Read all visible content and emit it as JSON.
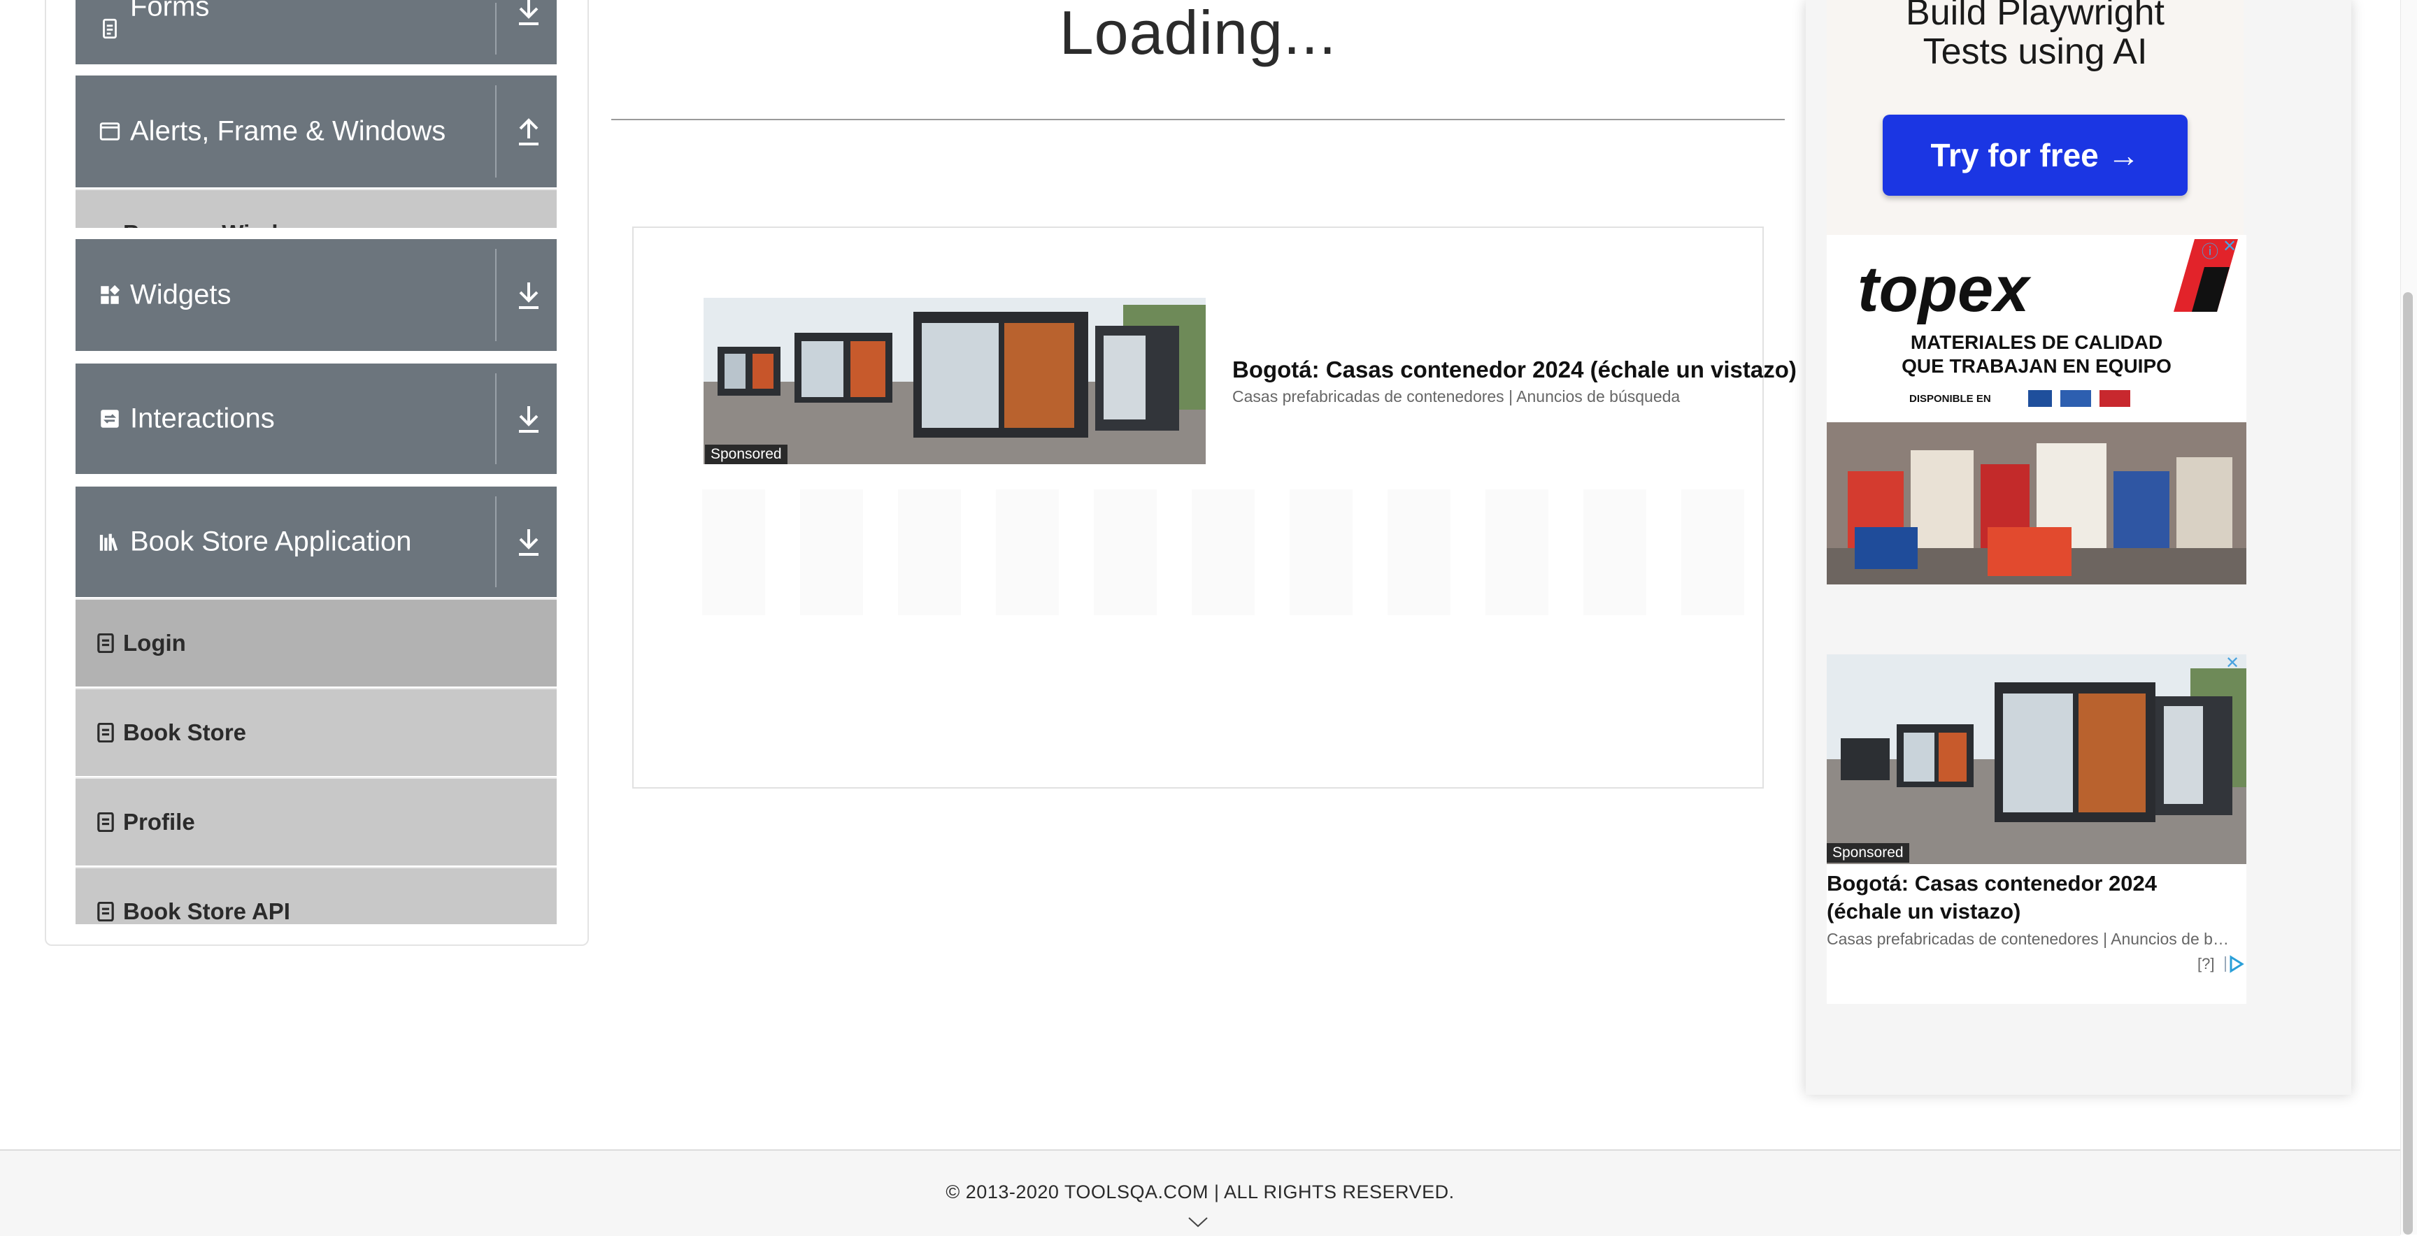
{
  "sidebar": {
    "groups": [
      {
        "label": "Forms",
        "icon": "form-icon",
        "toggle": "download"
      },
      {
        "label": "Alerts, Frame & Windows",
        "icon": "window-icon",
        "toggle": "upload"
      },
      {
        "label": "Widgets",
        "icon": "widgets-icon",
        "toggle": "download"
      },
      {
        "label": "Interactions",
        "icon": "interactions-icon",
        "toggle": "download"
      },
      {
        "label": "Book Store Application",
        "icon": "books-icon",
        "toggle": "download"
      }
    ],
    "alerts_partial_item": "Browser Windows",
    "book_store_items": [
      {
        "label": "Login",
        "active": true
      },
      {
        "label": "Book Store",
        "active": false
      },
      {
        "label": "Profile",
        "active": false
      },
      {
        "label": "Book Store API",
        "active": false
      }
    ]
  },
  "main": {
    "loading_text": "Loading...",
    "ad": {
      "sponsored": "Sponsored",
      "title": "Bogotá: Casas contenedor 2024 (échale un vistazo)",
      "subtitle": "Casas prefabricadas de contenedores | Anuncios de búsqueda"
    }
  },
  "right_ads": {
    "playwright": {
      "title_line1": "Build Playwright",
      "title_line2": "Tests using AI",
      "button": "Try for free →",
      "button_color": "#1b36e3"
    },
    "topex": {
      "brand": "topex",
      "tagline1": "MATERIALES DE CALIDAD",
      "tagline2": "QUE TRABAJAN EN EQUIPO",
      "available": "DISPONIBLE EN",
      "close": "✕",
      "info": "ⓘ"
    },
    "house_ad": {
      "sponsored": "Sponsored",
      "title_line1": "Bogotá: Casas contenedor 2024",
      "title_line2": "(échale un vistazo)",
      "subtitle": "Casas prefabricadas de contenedores | Anuncios de b…",
      "help": "[?]",
      "close": "✕"
    }
  },
  "footer": {
    "copyright": "© 2013-2020 TOOLSQA.COM | ALL RIGHTS RESERVED."
  },
  "colors": {
    "header_gray": "#6c757d",
    "item_gray": "#c8c8c8",
    "item_active": "#b2b2b2"
  }
}
